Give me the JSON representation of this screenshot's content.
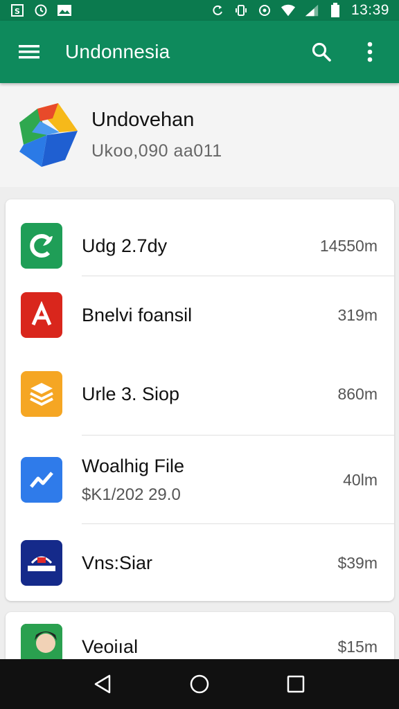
{
  "status_bar": {
    "time": "13:39",
    "icons_left": [
      "sim-icon",
      "clock-icon",
      "image-icon"
    ],
    "icons_right": [
      "sync-icon",
      "vibrate-icon",
      "settings-icon",
      "wifi-icon",
      "signal-icon",
      "battery-icon"
    ]
  },
  "app_bar": {
    "title": "Undonnesia",
    "menu_icon": "hamburger-menu-icon",
    "search_icon": "search-icon",
    "overflow_icon": "overflow-menu-icon"
  },
  "profile": {
    "name": "Undovehan",
    "subtitle": "Ukoo,090 aа011"
  },
  "apps": [
    {
      "label": "Udg 2.7dy",
      "size": "14550m",
      "icon": "c-leaf-icon",
      "color": "#1f9e57"
    },
    {
      "label": "Bnelvi foansil",
      "size": "319m",
      "icon": "a-letter-icon",
      "color": "#d9261c"
    },
    {
      "label": "Urle 3. Siop",
      "size": "860m",
      "icon": "stack-icon",
      "color": "#f5a623"
    },
    {
      "label": "Woalhig File",
      "subtitle": "$K1/202 29.0",
      "size": "40lm",
      "icon": "chart-icon",
      "color": "#2f7bea"
    },
    {
      "label": "Vns:Siar",
      "size": "$39m",
      "icon": "badge-icon",
      "color": "#152a8a"
    }
  ],
  "second_card": {
    "label": "Veoiıal",
    "size": "$15m",
    "icon": "person-avatar-icon"
  },
  "nav": {
    "back": "back-icon",
    "home": "home-icon",
    "recents": "recents-icon"
  },
  "colors": {
    "status_bar": "#0b7a4e",
    "app_bar": "#0e8a5c",
    "nav_bar": "#111111"
  }
}
